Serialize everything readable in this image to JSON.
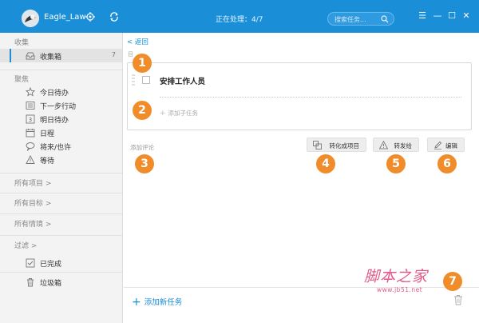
{
  "header": {
    "username": "Eagle_Law",
    "status": "正在处理：4/7",
    "search_placeholder": "搜索任务...",
    "window_controls": {
      "menu": "☰",
      "minimize": "—",
      "maximize": "☐",
      "close": "✕"
    },
    "accent_color": "#1a8fd8"
  },
  "sidebar": {
    "inbox_section": "收集",
    "inbox": {
      "label": "收集箱",
      "count": "7"
    },
    "focus_section": "聚焦",
    "focus_items": [
      {
        "label": "今日待办",
        "icon": "star-icon"
      },
      {
        "label": "下一步行动",
        "icon": "list-icon"
      },
      {
        "label": "明日待办",
        "icon": "calendar-3-icon"
      },
      {
        "label": "日程",
        "icon": "calendar-icon"
      },
      {
        "label": "将来/也许",
        "icon": "speech-bubble-icon"
      },
      {
        "label": "等待",
        "icon": "warning-triangle-icon"
      }
    ],
    "groups": [
      {
        "label": "所有项目",
        "chevron": ">"
      },
      {
        "label": "所有目标",
        "chevron": ">"
      },
      {
        "label": "所有情境",
        "chevron": ">"
      },
      {
        "label": "过滤",
        "chevron": ">"
      }
    ],
    "completed": "已完成",
    "trash": "垃圾箱"
  },
  "main": {
    "back": "返回",
    "small_label": "目",
    "task_title": "安排工作人员",
    "add_subtask": "添加子任务",
    "add_comment": "添加评论",
    "buttons": {
      "convert": "转化成项目",
      "forward": "转发给",
      "edit": "编辑"
    },
    "add_task": "添加新任务"
  },
  "markers": [
    "1",
    "2",
    "3",
    "4",
    "5",
    "6",
    "7"
  ],
  "marker_color": "#f08d2a",
  "watermark": {
    "main": "脚本之家",
    "sub": "www.jb51.net"
  }
}
